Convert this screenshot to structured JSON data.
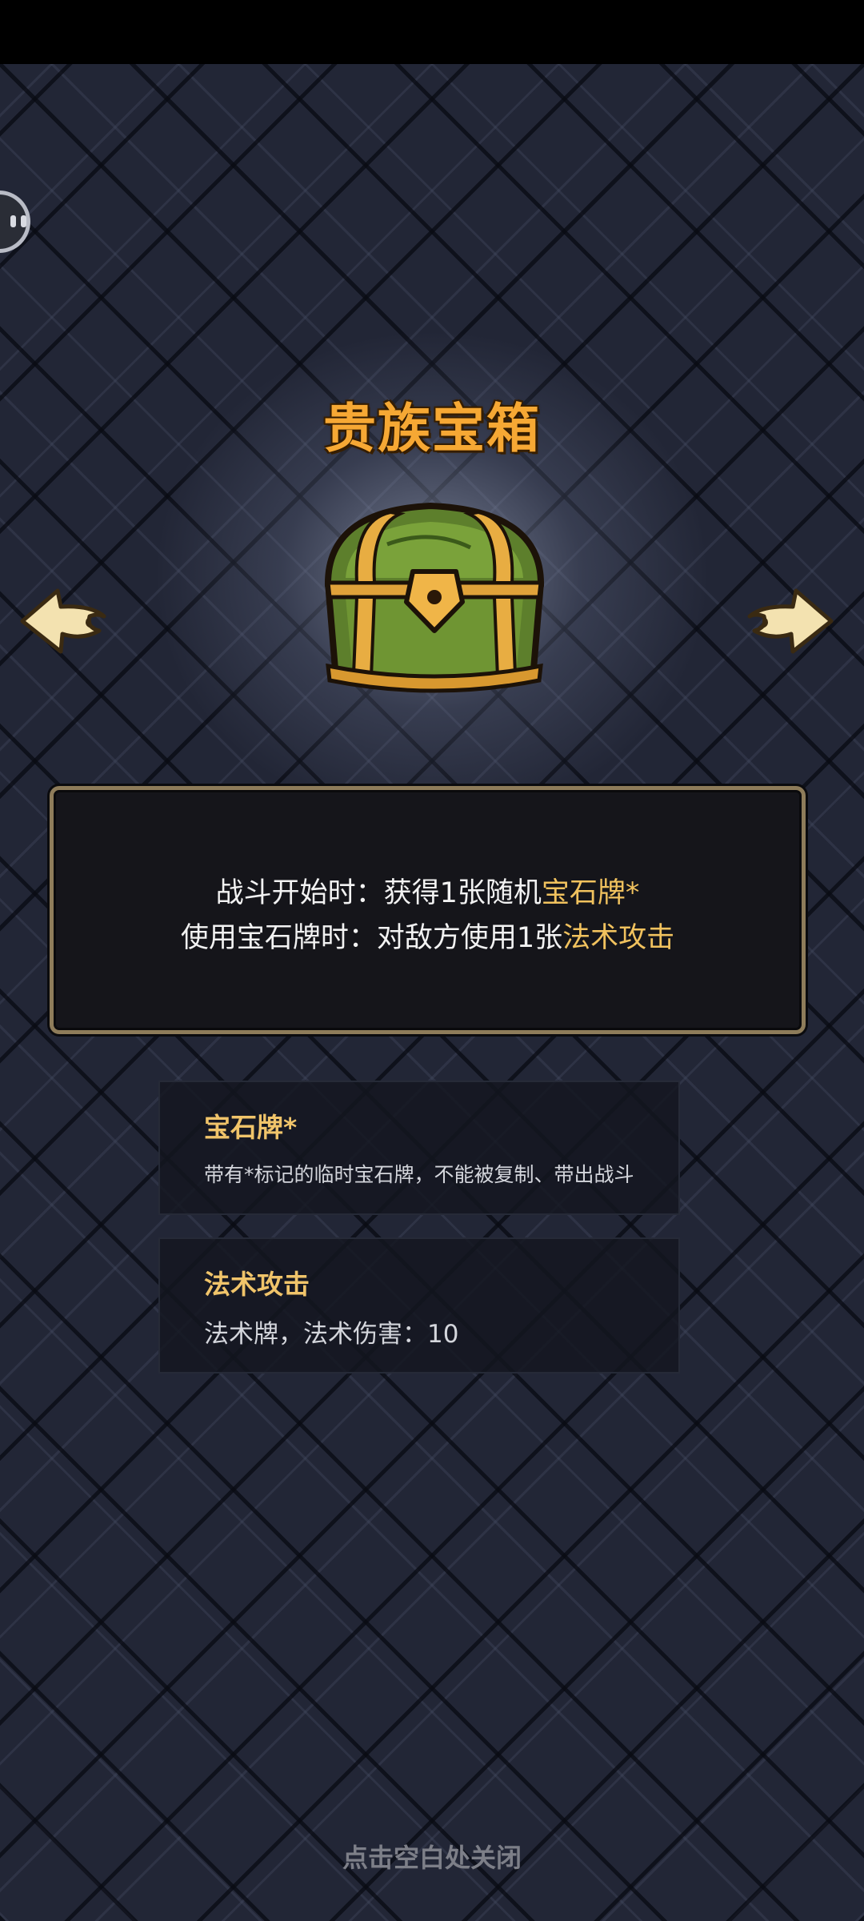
{
  "chest": {
    "title": "贵族宝箱",
    "image_icon": "treasure-chest-icon"
  },
  "navigation": {
    "prev_icon": "arrow-left-icon",
    "next_icon": "arrow-right-icon"
  },
  "description": {
    "line1_prefix": "战斗开始时：获得1张随机",
    "line1_highlight": "宝石牌*",
    "line2_prefix": "使用宝石牌时：对敌方使用1张",
    "line2_highlight": "法术攻击"
  },
  "keywords": [
    {
      "title": "宝石牌*",
      "text": "带有*标记的临时宝石牌，不能被复制、带出战斗"
    },
    {
      "title": "法术攻击",
      "text": "法术牌，法术伤害：10"
    }
  ],
  "footer": {
    "close_hint": "点击空白处关闭"
  },
  "colors": {
    "title": "#f6a834",
    "highlight": "#f1c25e",
    "panel_border": "#8e7c5a",
    "background": "#222636"
  },
  "floating_button_icon": "assistant-bubble-icon"
}
